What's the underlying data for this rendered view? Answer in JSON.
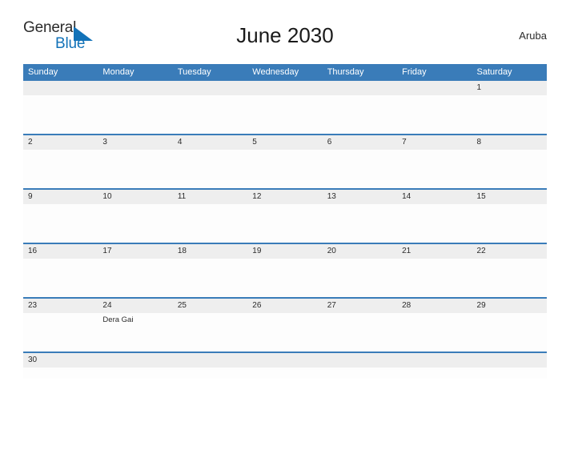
{
  "brand": {
    "name_top": "General",
    "name_bottom": "Blue",
    "flag_icon": "triangle-flag-icon",
    "accent_color": "#1272b8"
  },
  "header": {
    "title": "June 2030",
    "location": "Aruba",
    "header_color": "#3a7cb9",
    "band_color": "#eeeeee"
  },
  "calendar": {
    "month": "June",
    "year": "2030",
    "weekdays": [
      "Sunday",
      "Monday",
      "Tuesday",
      "Wednesday",
      "Thursday",
      "Friday",
      "Saturday"
    ],
    "weeks": [
      {
        "days": [
          {
            "date": "",
            "events": []
          },
          {
            "date": "",
            "events": []
          },
          {
            "date": "",
            "events": []
          },
          {
            "date": "",
            "events": []
          },
          {
            "date": "",
            "events": []
          },
          {
            "date": "",
            "events": []
          },
          {
            "date": "1",
            "events": []
          }
        ]
      },
      {
        "days": [
          {
            "date": "2",
            "events": []
          },
          {
            "date": "3",
            "events": []
          },
          {
            "date": "4",
            "events": []
          },
          {
            "date": "5",
            "events": []
          },
          {
            "date": "6",
            "events": []
          },
          {
            "date": "7",
            "events": []
          },
          {
            "date": "8",
            "events": []
          }
        ]
      },
      {
        "days": [
          {
            "date": "9",
            "events": []
          },
          {
            "date": "10",
            "events": []
          },
          {
            "date": "11",
            "events": []
          },
          {
            "date": "12",
            "events": []
          },
          {
            "date": "13",
            "events": []
          },
          {
            "date": "14",
            "events": []
          },
          {
            "date": "15",
            "events": []
          }
        ]
      },
      {
        "days": [
          {
            "date": "16",
            "events": []
          },
          {
            "date": "17",
            "events": []
          },
          {
            "date": "18",
            "events": []
          },
          {
            "date": "19",
            "events": []
          },
          {
            "date": "20",
            "events": []
          },
          {
            "date": "21",
            "events": []
          },
          {
            "date": "22",
            "events": []
          }
        ]
      },
      {
        "days": [
          {
            "date": "23",
            "events": []
          },
          {
            "date": "24",
            "events": [
              "Dera Gai"
            ]
          },
          {
            "date": "25",
            "events": []
          },
          {
            "date": "26",
            "events": []
          },
          {
            "date": "27",
            "events": []
          },
          {
            "date": "28",
            "events": []
          },
          {
            "date": "29",
            "events": []
          }
        ]
      },
      {
        "days": [
          {
            "date": "30",
            "events": []
          },
          {
            "date": "",
            "events": []
          },
          {
            "date": "",
            "events": []
          },
          {
            "date": "",
            "events": []
          },
          {
            "date": "",
            "events": []
          },
          {
            "date": "",
            "events": []
          },
          {
            "date": "",
            "events": []
          }
        ]
      }
    ]
  }
}
